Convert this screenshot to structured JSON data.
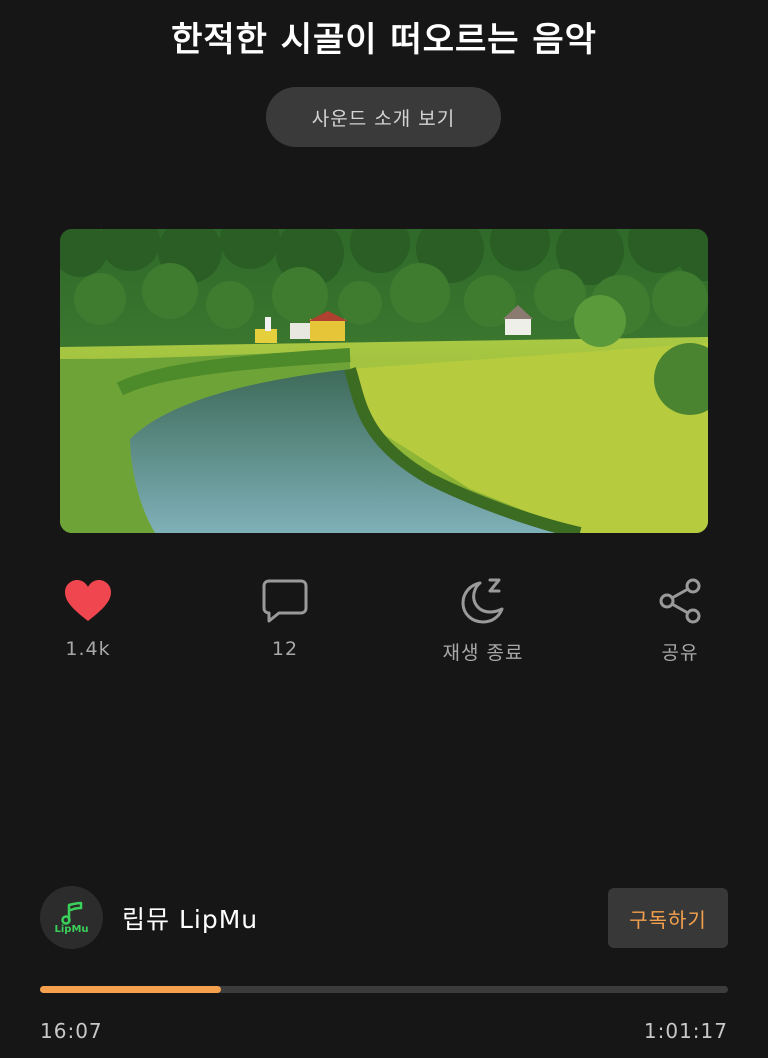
{
  "title": "한적한 시골이 떠오르는 음악",
  "intro_button": "사운드 소개 보기",
  "thumbnail": {
    "icon": "countryside-river-image"
  },
  "actions": {
    "like": {
      "count": "1.4k",
      "icon": "heart-icon",
      "color": "#f0464f"
    },
    "comment": {
      "count": "12",
      "icon": "comment-icon"
    },
    "sleep_timer": {
      "label": "재생 종료",
      "icon": "moon-sleep-icon"
    },
    "share": {
      "label": "공유",
      "icon": "share-icon"
    }
  },
  "channel": {
    "name": "립뮤 LipMu",
    "avatar_text": "LipMu",
    "subscribe_label": "구독하기"
  },
  "player": {
    "current_time": "16:07",
    "total_time": "1:01:17",
    "progress": 0.263,
    "accent": "#f5a04c"
  }
}
